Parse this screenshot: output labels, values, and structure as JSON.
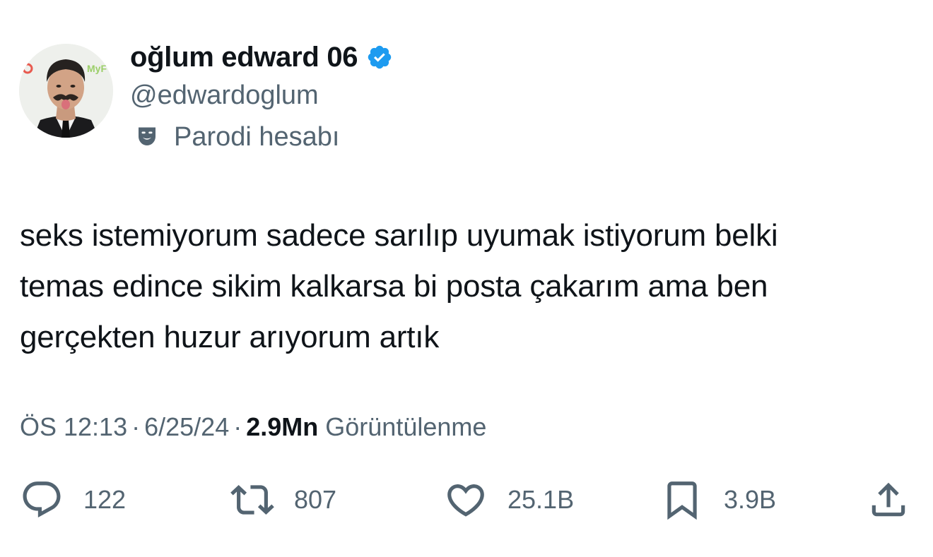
{
  "author": {
    "display_name": "oğlum edward 06",
    "handle": "@edwardoglum",
    "parody_label": "Parodi hesabı",
    "verified": true,
    "verified_color": "#1d9bf0"
  },
  "tweet": {
    "lines": [
      "seks istemiyorum sadece sarılıp uyumak istiyorum belki",
      "temas edince sikim kalkarsa bi posta çakarım ama ben",
      "gerçekten huzur arıyorum artık"
    ]
  },
  "meta": {
    "time": "ÖS 12:13",
    "date": "6/25/24",
    "separator": "·",
    "views_count": "2.9Mn",
    "views_label": "Görüntülenme"
  },
  "actions": {
    "reply": {
      "icon": "reply-icon",
      "count": "122"
    },
    "retweet": {
      "icon": "retweet-icon",
      "count": "807"
    },
    "like": {
      "icon": "heart-icon",
      "count": "25.1B"
    },
    "bookmark": {
      "icon": "bookmark-icon",
      "count": "3.9B"
    },
    "share": {
      "icon": "share-icon"
    }
  },
  "colors": {
    "text_primary": "#0f1419",
    "text_secondary": "#536471",
    "background": "#ffffff"
  }
}
